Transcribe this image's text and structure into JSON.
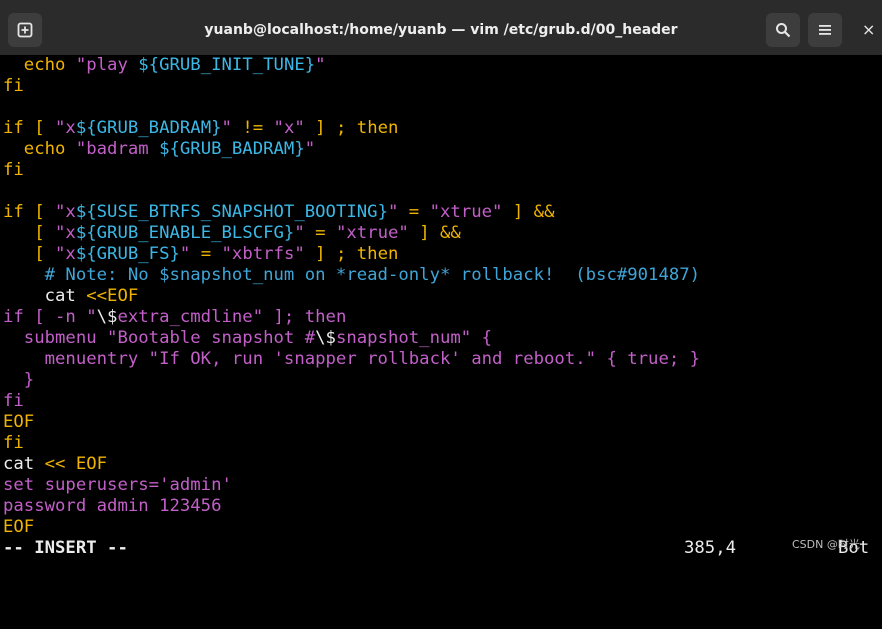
{
  "window": {
    "title": "yuanb@localhost:/home/yuanb — vim /etc/grub.d/00_header",
    "new_tab_icon": "new-tab-icon",
    "search_icon": "search-icon",
    "menu_icon": "hamburger-menu-icon",
    "close_glyph": "×"
  },
  "colors": {
    "keyword": "#f0b400",
    "variable": "#3bb8e6",
    "string": "#c25fc8",
    "comment": "#3fa5d8",
    "default": "#ececec",
    "background": "#000000",
    "titlebar": "#2b2b2b"
  },
  "editor": {
    "lines": [
      [
        {
          "t": "  echo ",
          "c": "yel"
        },
        {
          "t": "\"play ",
          "c": "mag"
        },
        {
          "t": "${GRUB_INIT_TUNE}",
          "c": "cyan"
        },
        {
          "t": "\"",
          "c": "mag"
        }
      ],
      [
        {
          "t": "fi",
          "c": "yel"
        }
      ],
      [],
      [
        {
          "t": "if [ ",
          "c": "yel"
        },
        {
          "t": "\"x",
          "c": "mag"
        },
        {
          "t": "${GRUB_BADRAM}",
          "c": "cyan"
        },
        {
          "t": "\"",
          "c": "mag"
        },
        {
          "t": " != ",
          "c": "yel"
        },
        {
          "t": "\"x\"",
          "c": "mag"
        },
        {
          "t": " ] ; then",
          "c": "yel"
        }
      ],
      [
        {
          "t": "  echo ",
          "c": "yel"
        },
        {
          "t": "\"badram ",
          "c": "mag"
        },
        {
          "t": "${GRUB_BADRAM}",
          "c": "cyan"
        },
        {
          "t": "\"",
          "c": "mag"
        }
      ],
      [
        {
          "t": "fi",
          "c": "yel"
        }
      ],
      [],
      [
        {
          "t": "if [ ",
          "c": "yel"
        },
        {
          "t": "\"x",
          "c": "mag"
        },
        {
          "t": "${SUSE_BTRFS_SNAPSHOT_BOOTING}",
          "c": "cyan"
        },
        {
          "t": "\"",
          "c": "mag"
        },
        {
          "t": " = ",
          "c": "yel"
        },
        {
          "t": "\"xtrue\"",
          "c": "mag"
        },
        {
          "t": " ] &&",
          "c": "yel"
        }
      ],
      [
        {
          "t": "   [ ",
          "c": "yel"
        },
        {
          "t": "\"x",
          "c": "mag"
        },
        {
          "t": "${GRUB_ENABLE_BLSCFG}",
          "c": "cyan"
        },
        {
          "t": "\"",
          "c": "mag"
        },
        {
          "t": " = ",
          "c": "yel"
        },
        {
          "t": "\"xtrue\"",
          "c": "mag"
        },
        {
          "t": " ] &&",
          "c": "yel"
        }
      ],
      [
        {
          "t": "   [ ",
          "c": "yel"
        },
        {
          "t": "\"x",
          "c": "mag"
        },
        {
          "t": "${GRUB_FS}",
          "c": "cyan"
        },
        {
          "t": "\"",
          "c": "mag"
        },
        {
          "t": " = ",
          "c": "yel"
        },
        {
          "t": "\"xbtrfs\"",
          "c": "mag"
        },
        {
          "t": " ] ; then",
          "c": "yel"
        }
      ],
      [
        {
          "t": "    # Note: No $snapshot_num on *read-only* rollback!  (bsc#901487)",
          "c": "cmt"
        }
      ],
      [
        {
          "t": "    cat ",
          "c": "wht"
        },
        {
          "t": "<<EOF",
          "c": "yel"
        }
      ],
      [
        {
          "t": "if [ -n \"",
          "c": "mag"
        },
        {
          "t": "\\$",
          "c": "wht"
        },
        {
          "t": "extra_cmdline\" ]; then",
          "c": "mag"
        }
      ],
      [
        {
          "t": "  submenu \"Bootable snapshot #",
          "c": "mag"
        },
        {
          "t": "\\$",
          "c": "wht"
        },
        {
          "t": "snapshot_num\" {",
          "c": "mag"
        }
      ],
      [
        {
          "t": "    menuentry \"If OK, run 'snapper rollback' and reboot.\" { true; }",
          "c": "mag"
        }
      ],
      [
        {
          "t": "  }",
          "c": "mag"
        }
      ],
      [
        {
          "t": "fi",
          "c": "mag"
        }
      ],
      [
        {
          "t": "EOF",
          "c": "yel"
        }
      ],
      [
        {
          "t": "fi",
          "c": "yel"
        }
      ],
      [
        {
          "t": "cat ",
          "c": "wht"
        },
        {
          "t": "<< EOF",
          "c": "yel"
        }
      ],
      [
        {
          "t": "set superusers='admin'",
          "c": "mag"
        }
      ],
      [
        {
          "t": "password admin 123456",
          "c": "mag"
        }
      ],
      [
        {
          "t": "EOF",
          "c": "yel"
        }
      ]
    ]
  },
  "status": {
    "mode": "-- INSERT --",
    "position": "385,4",
    "scroll": "Bot"
  },
  "watermark": "CSDN @时光"
}
